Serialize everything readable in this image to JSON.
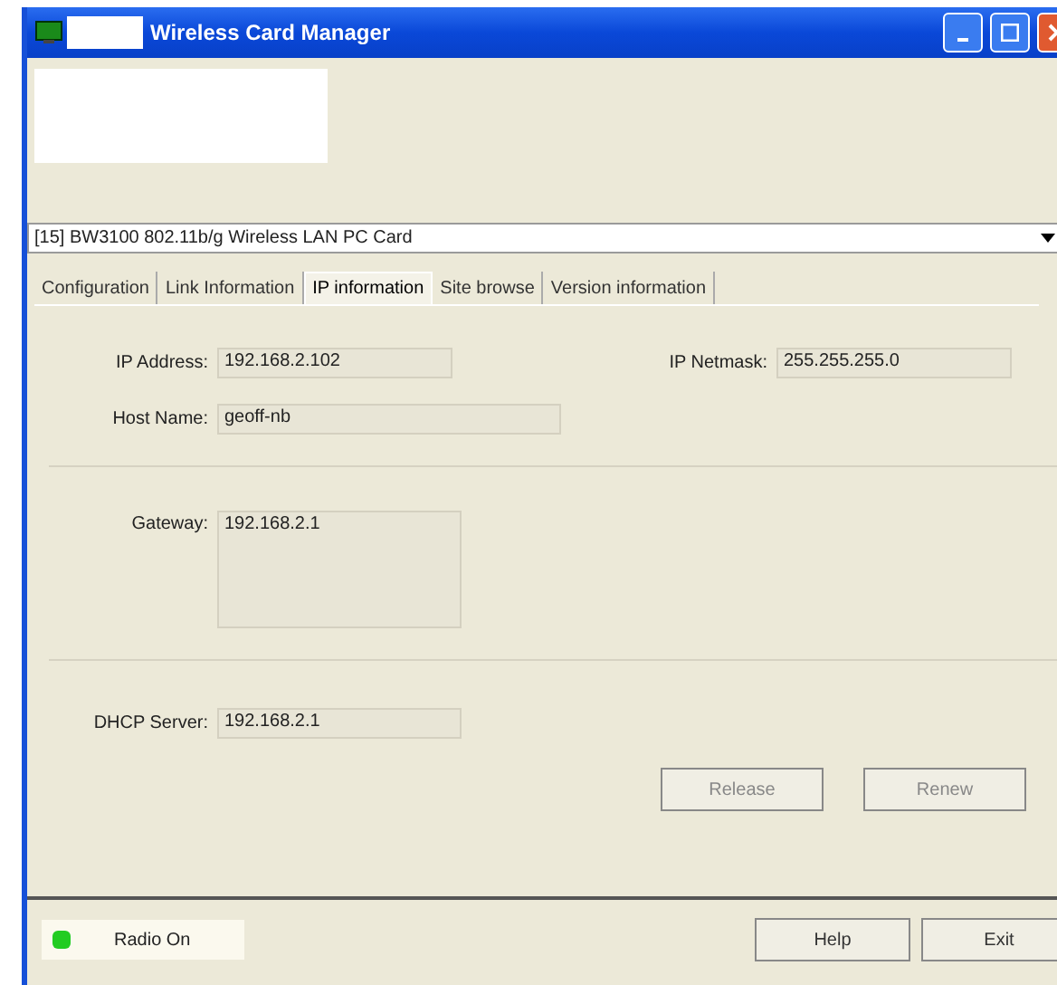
{
  "window": {
    "title": "Wireless Card Manager"
  },
  "adapter": {
    "value": "[15] BW3100 802.11b/g Wireless LAN PC Card"
  },
  "tabs": [
    {
      "label": "Configuration",
      "selected": false
    },
    {
      "label": "Link Information",
      "selected": false
    },
    {
      "label": "IP information",
      "selected": true
    },
    {
      "label": "Site browse",
      "selected": false
    },
    {
      "label": "Version information",
      "selected": false
    }
  ],
  "ip_address": {
    "label": "IP Address:",
    "value": "192.168.2.102"
  },
  "ip_netmask": {
    "label": "IP Netmask:",
    "value": "255.255.255.0"
  },
  "host_name": {
    "label": "Host Name:",
    "value": "geoff-nb"
  },
  "gateway": {
    "label": "Gateway:",
    "value": "192.168.2.1"
  },
  "dhcp_server": {
    "label": "DHCP Server:",
    "value": "192.168.2.1"
  },
  "actions": [
    {
      "label": "Release",
      "disabled": true
    },
    {
      "label": "Renew",
      "disabled": true
    }
  ],
  "status_bar": {
    "radio": {
      "label": "Radio On",
      "on": true
    },
    "buttons": [
      {
        "label": "Help"
      },
      {
        "label": "Exit"
      }
    ]
  }
}
